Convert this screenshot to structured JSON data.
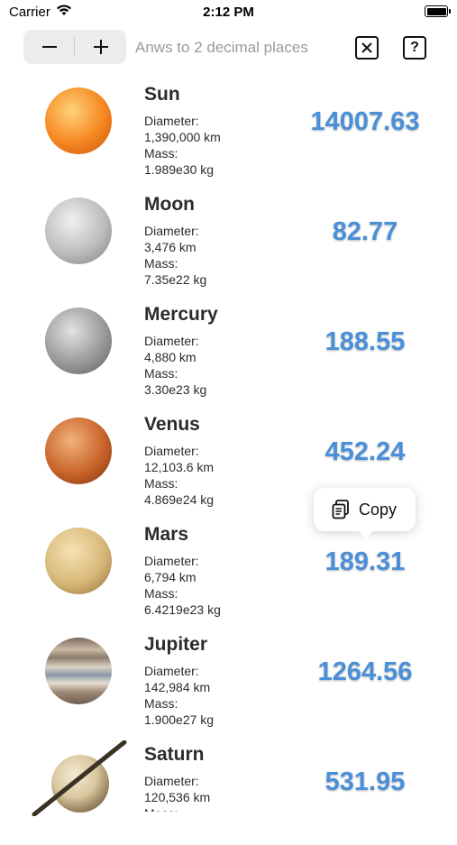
{
  "status_bar": {
    "carrier": "Carrier",
    "time": "2:12 PM"
  },
  "toolbar": {
    "minus_label": "−",
    "plus_label": "+",
    "hint": "Anws to 2 decimal places",
    "close_icon": "close-box-icon",
    "help_label": "?"
  },
  "planets": [
    {
      "name": "Sun",
      "diameter_label": "Diameter:",
      "diameter": "1,390,000 km",
      "mass_label": "Mass:",
      "mass": "1.989e30 kg",
      "value": "14007.63",
      "color": "#f08a1e"
    },
    {
      "name": "Moon",
      "diameter_label": "Diameter:",
      "diameter": "3,476 km",
      "mass_label": "Mass:",
      "mass": "7.35e22 kg",
      "value": "82.77",
      "color": "#b9b9b9"
    },
    {
      "name": "Mercury",
      "diameter_label": "Diameter:",
      "diameter": "4,880 km",
      "mass_label": "Mass:",
      "mass": "3.30e23 kg",
      "value": "188.55",
      "color": "#9a9a9a"
    },
    {
      "name": "Venus",
      "diameter_label": "Diameter:",
      "diameter": "12,103.6 km",
      "mass_label": "Mass:",
      "mass": "4.869e24 kg",
      "value": "452.24",
      "color": "#c9642b"
    },
    {
      "name": "Mars",
      "diameter_label": "Diameter:",
      "diameter": "6,794 km",
      "mass_label": "Mass:",
      "mass": "6.4219e23 kg",
      "value": "189.31",
      "color": "#d8b879"
    },
    {
      "name": "Jupiter",
      "diameter_label": "Diameter:",
      "diameter": "142,984 km",
      "mass_label": "Mass:",
      "mass": "1.900e27 kg",
      "value": "1264.56",
      "color": "#a9998a"
    },
    {
      "name": "Saturn",
      "diameter_label": "Diameter:",
      "diameter": "120,536 km",
      "mass_label": "Mass:",
      "mass": "",
      "value": "531.95",
      "color": "#d9c7a0"
    }
  ],
  "copy_menu": {
    "label": "Copy",
    "icon": "copy-icon"
  },
  "colors": {
    "value_blue": "#4a90d9",
    "stepper_bg": "#ececee"
  }
}
